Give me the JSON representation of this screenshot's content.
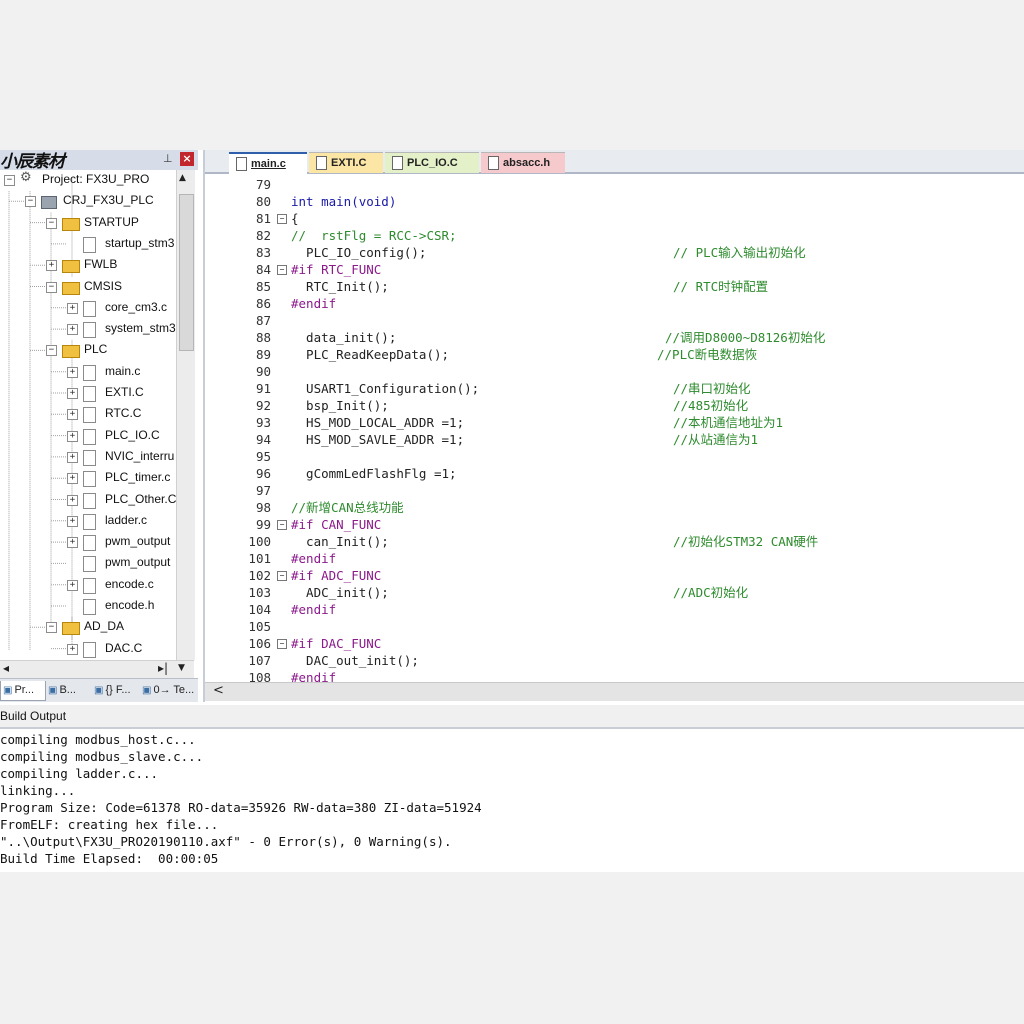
{
  "project_panel": {
    "title": "小辰素材",
    "pin": "⊥",
    "close": "×",
    "tree": [
      {
        "label": "Project: FX3U_PRO",
        "icon": "project-icon",
        "toggle": "−"
      },
      {
        "label": "CRJ_FX3U_PLC",
        "icon": "target-icon",
        "toggle": "−"
      },
      {
        "label": "STARTUP",
        "icon": "folder-icon",
        "toggle": "−"
      },
      {
        "label": "startup_stm3",
        "icon": "file-icon",
        "toggle": ""
      },
      {
        "label": "FWLB",
        "icon": "folder-icon",
        "toggle": "+"
      },
      {
        "label": "CMSIS",
        "icon": "folder-icon",
        "toggle": "−"
      },
      {
        "label": "core_cm3.c",
        "icon": "file-icon",
        "toggle": "+"
      },
      {
        "label": "system_stm3",
        "icon": "file-icon",
        "toggle": "+"
      },
      {
        "label": "PLC",
        "icon": "folder-icon",
        "toggle": "−"
      },
      {
        "label": "main.c",
        "icon": "file-icon",
        "toggle": "+"
      },
      {
        "label": "EXTI.C",
        "icon": "file-icon",
        "toggle": "+"
      },
      {
        "label": "RTC.C",
        "icon": "file-icon",
        "toggle": "+"
      },
      {
        "label": "PLC_IO.C",
        "icon": "file-icon",
        "toggle": "+"
      },
      {
        "label": "NVIC_interru",
        "icon": "file-icon",
        "toggle": "+"
      },
      {
        "label": "PLC_timer.c",
        "icon": "file-icon",
        "toggle": "+"
      },
      {
        "label": "PLC_Other.C",
        "icon": "file-icon",
        "toggle": "+"
      },
      {
        "label": "ladder.c",
        "icon": "file-icon",
        "toggle": "+"
      },
      {
        "label": "pwm_output",
        "icon": "file-icon",
        "toggle": "+"
      },
      {
        "label": "pwm_output",
        "icon": "file-icon",
        "toggle": ""
      },
      {
        "label": "encode.c",
        "icon": "file-icon",
        "toggle": "+"
      },
      {
        "label": "encode.h",
        "icon": "file-icon",
        "toggle": ""
      },
      {
        "label": "AD_DA",
        "icon": "folder-icon",
        "toggle": "−"
      },
      {
        "label": "DAC.C",
        "icon": "file-icon",
        "toggle": "+"
      }
    ],
    "bottom_tabs": [
      {
        "label": "Pr...",
        "icon": "project-tab-icon"
      },
      {
        "label": "B...",
        "icon": "books-tab-icon"
      },
      {
        "label": "{} F...",
        "icon": "functions-tab-icon"
      },
      {
        "label": "0→ Te...",
        "icon": "templates-tab-icon"
      }
    ]
  },
  "editor": {
    "tabs": [
      {
        "label": "main.c",
        "bg": "#ffffff",
        "active": true
      },
      {
        "label": "EXTI.C",
        "bg": "#fce6a6",
        "active": false
      },
      {
        "label": "PLC_IO.C",
        "bg": "#e4f0c8",
        "active": false
      },
      {
        "label": "absacc.h",
        "bg": "#f6c9cd",
        "active": false
      }
    ],
    "lines": [
      {
        "n": "79",
        "code": "",
        "fold": "",
        "comment": ""
      },
      {
        "n": "80",
        "code": "int main(void)",
        "fold": "",
        "comment": ""
      },
      {
        "n": "81",
        "code": "{",
        "fold": "−",
        "comment": ""
      },
      {
        "n": "82",
        "code": "//  rstFlg = RCC->CSR;",
        "fold": "",
        "comment": ""
      },
      {
        "n": "83",
        "code": "  PLC_IO_config();",
        "fold": "",
        "comment": "// PLC输入输出初始化"
      },
      {
        "n": "84",
        "code": "#if RTC_FUNC",
        "fold": "−",
        "comment": ""
      },
      {
        "n": "85",
        "code": "  RTC_Init();",
        "fold": "",
        "comment": "// RTC时钟配置"
      },
      {
        "n": "86",
        "code": "#endif",
        "fold": "",
        "comment": ""
      },
      {
        "n": "87",
        "code": "",
        "fold": "",
        "comment": ""
      },
      {
        "n": "88",
        "code": "  data_init();",
        "fold": "",
        "comment": "//调用D8000~D8126初始化"
      },
      {
        "n": "89",
        "code": "  PLC_ReadKeepData();",
        "fold": "",
        "comment": "//PLC断电数据恢"
      },
      {
        "n": "90",
        "code": "",
        "fold": "",
        "comment": ""
      },
      {
        "n": "91",
        "code": "  USART1_Configuration();",
        "fold": "",
        "comment": "//串口初始化"
      },
      {
        "n": "92",
        "code": "  bsp_Init();",
        "fold": "",
        "comment": "//485初始化"
      },
      {
        "n": "93",
        "code": "  HS_MOD_LOCAL_ADDR =1;",
        "fold": "",
        "comment": "//本机通信地址为1"
      },
      {
        "n": "94",
        "code": "  HS_MOD_SAVLE_ADDR =1;",
        "fold": "",
        "comment": "//从站通信为1"
      },
      {
        "n": "95",
        "code": "",
        "fold": "",
        "comment": ""
      },
      {
        "n": "96",
        "code": "  gCommLedFlashFlg =1;",
        "fold": "",
        "comment": ""
      },
      {
        "n": "97",
        "code": "",
        "fold": "",
        "comment": ""
      },
      {
        "n": "98",
        "code": "//新增CAN总线功能",
        "fold": "",
        "comment": ""
      },
      {
        "n": "99",
        "code": "#if CAN_FUNC",
        "fold": "−",
        "comment": ""
      },
      {
        "n": "100",
        "code": "  can_Init();",
        "fold": "",
        "comment": "//初始化STM32 CAN硬件"
      },
      {
        "n": "101",
        "code": "#endif",
        "fold": "",
        "comment": ""
      },
      {
        "n": "102",
        "code": "#if ADC_FUNC",
        "fold": "−",
        "comment": ""
      },
      {
        "n": "103",
        "code": "  ADC_init();",
        "fold": "",
        "comment": "//ADC初始化"
      },
      {
        "n": "104",
        "code": "#endif",
        "fold": "",
        "comment": ""
      },
      {
        "n": "105",
        "code": "",
        "fold": "",
        "comment": ""
      },
      {
        "n": "106",
        "code": "#if DAC_FUNC",
        "fold": "−",
        "comment": ""
      },
      {
        "n": "107",
        "code": "  DAC_out_init();",
        "fold": "",
        "comment": ""
      },
      {
        "n": "108",
        "code": "#endif",
        "fold": "",
        "comment": ""
      }
    ],
    "scroll_left": "<"
  },
  "build_output": {
    "title": "Build Output",
    "lines": [
      "compiling modbus_host.c...",
      "compiling modbus_slave.c...",
      "compiling ladder.c...",
      "linking...",
      "Program Size: Code=61378 RO-data=35926 RW-data=380 ZI-data=51924",
      "FromELF: creating hex file...",
      "\"..\\Output\\FX3U_PRO20190110.axf\" - 0 Error(s), 0 Warning(s).",
      "Build Time Elapsed:  00:00:05"
    ]
  }
}
